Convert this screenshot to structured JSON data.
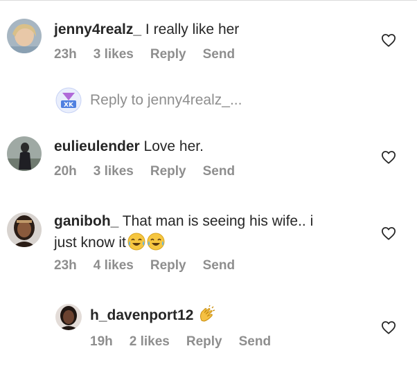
{
  "comments": [
    {
      "username": "jenny4realz_",
      "text": " I really like her",
      "time": "23h",
      "likes": "3 likes",
      "reply": "Reply",
      "send": "Send"
    },
    {
      "username": "eulieulender",
      "text": " Love her.",
      "time": "20h",
      "likes": "3 likes",
      "reply": "Reply",
      "send": "Send"
    },
    {
      "username": "ganiboh_",
      "text_line1": " That man is seeing his wife.. i",
      "text_line2": "just know it",
      "time": "23h",
      "likes": "4 likes",
      "reply": "Reply",
      "send": "Send"
    },
    {
      "username": "h_davenport12",
      "time": "19h",
      "likes": "2 likes",
      "reply": "Reply",
      "send": "Send"
    }
  ],
  "reply_prompt": {
    "prefix": "Reply to ",
    "target": "jenny4realz_..."
  },
  "icons": {
    "like": "heart-outline-icon",
    "laugh": "face-with-tears-of-joy-emoji",
    "clap": "clapping-hands-emoji"
  },
  "colors": {
    "text": "#262626",
    "secondary": "#8e8e8e",
    "badge_purple": "#8b5cf6",
    "badge_blue": "#3b82f6"
  }
}
